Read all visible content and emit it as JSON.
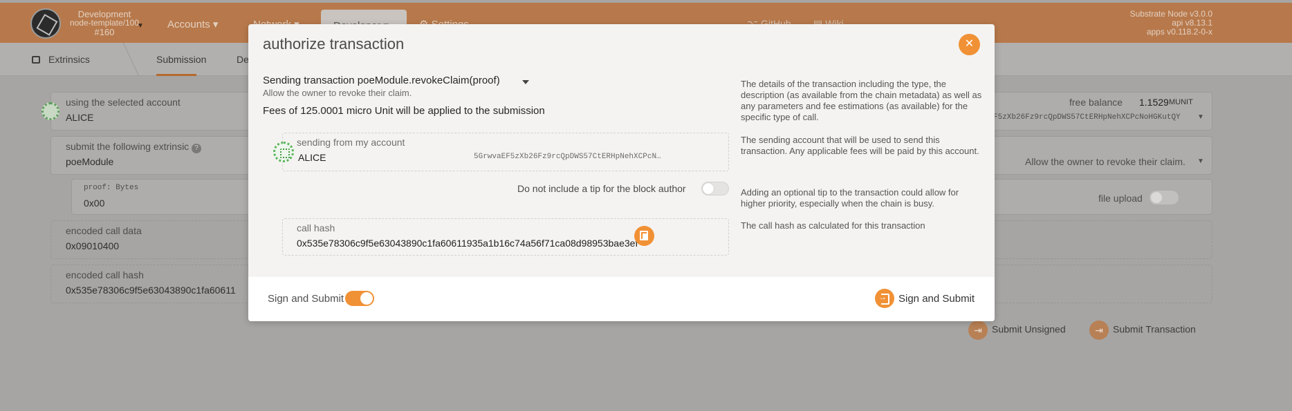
{
  "background": {
    "chain": {
      "name": "Development",
      "node": "node-template/100",
      "block": "#160"
    },
    "nav": {
      "accounts": "Accounts",
      "network": "Network",
      "developer": "Developer",
      "settings": "Settings",
      "github": "GitHub",
      "wiki": "Wiki"
    },
    "versions": {
      "node": "Substrate Node v3.0.0",
      "api": "api v8.13.1",
      "apps": "apps v0.118.2-0-x"
    },
    "subnav": {
      "extrinsics": "Extrinsics",
      "submission": "Submission",
      "decode": "De"
    },
    "account": {
      "label": "using the selected account",
      "value": "ALICE",
      "free_balance_label": "free balance",
      "free_balance_value": "1.1529",
      "free_balance_unit": "MUNIT",
      "address": "F5zXb26Fz9rcQpDWS57CtERHpNehXCPcNoHGKutQY"
    },
    "extrinsic": {
      "label": "submit the following extrinsic",
      "module": "poeModule",
      "method_desc": "Allow the owner to revoke their claim."
    },
    "proof": {
      "label": "proof: Bytes",
      "value": "0x00",
      "file_upload": "file upload"
    },
    "call_data": {
      "label": "encoded call data",
      "value": "0x09010400"
    },
    "call_hash": {
      "label": "encoded call hash",
      "value": "0x535e78306c9f5e63043890c1fa60611"
    },
    "buttons": {
      "submit_unsigned": "Submit Unsigned",
      "submit_transaction": "Submit Transaction"
    }
  },
  "modal": {
    "title": "authorize transaction",
    "close_icon": "close-icon",
    "transaction": "Sending transaction poeModule.revokeClaim(proof)",
    "description": "Allow the owner to revoke their claim.",
    "fees": "Fees of 125.0001 micro Unit will be applied to the submission",
    "sender": {
      "label": "sending from my account",
      "name": "ALICE",
      "address": "5GrwvaEF5zXb26Fz9rcQpDWS57CtERHpNehXCPcN…"
    },
    "tip": {
      "label": "Do not include a tip for the block author",
      "enabled": false
    },
    "call_hash": {
      "label": "call hash",
      "value": "0x535e78306c9f5e63043890c1fa60611935a1b16c74a56f71ca08d98953bae3ef"
    },
    "help": {
      "details": "The details of the transaction including the type, the description (as available from the chain metadata) as well as any parameters and fee estimations (as available) for the specific type of call.",
      "sending": "The sending account that will be used to send this transaction. Any applicable fees will be paid by this account.",
      "tip": "Adding an optional tip to the transaction could allow for higher priority, especially when the chain is busy.",
      "hash": "The call hash as calculated for this transaction"
    },
    "footer": {
      "sign_label": "Sign and Submit",
      "sign_toggle_on": true,
      "sign_button": "Sign and Submit"
    },
    "colors": {
      "accent": "#f19135",
      "topbar": "#b7794b"
    }
  }
}
